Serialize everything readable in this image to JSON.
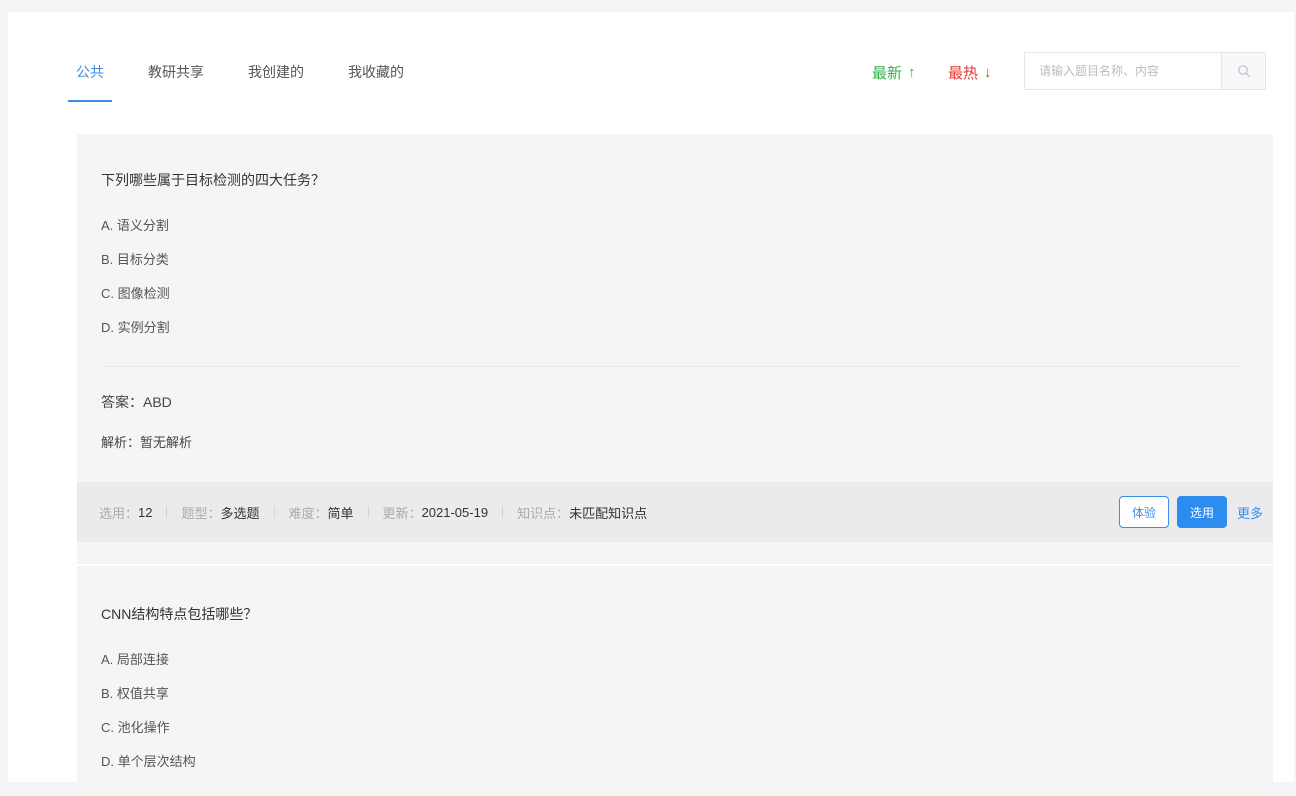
{
  "tabs": [
    {
      "label": "公共",
      "active": true
    },
    {
      "label": "教研共享",
      "active": false
    },
    {
      "label": "我创建的",
      "active": false
    },
    {
      "label": "我收藏的",
      "active": false
    }
  ],
  "sort": {
    "newest_label": "最新",
    "newest_arrow": "↑",
    "hottest_label": "最热",
    "hottest_arrow": "↓"
  },
  "search": {
    "placeholder": "请输入题目名称、内容",
    "icon": "search-icon"
  },
  "questions": [
    {
      "title": "下列哪些属于目标检测的四大任务？",
      "options": [
        "A. 语义分割",
        "B. 目标分类",
        "C. 图像检测",
        "D. 实例分割"
      ],
      "answer_label": "答案：",
      "answer": "ABD",
      "analysis_label": "解析：",
      "analysis": "暂无解析",
      "meta": {
        "used_label": "选用：",
        "used": "12",
        "type_label": "题型：",
        "type": "多选题",
        "difficulty_label": "难度：",
        "difficulty": "简单",
        "updated_label": "更新：",
        "updated": "2021-05-19",
        "knowledge_label": "知识点：",
        "knowledge": "未匹配知识点"
      },
      "actions": {
        "trial": "体验",
        "select": "选用",
        "more": "更多"
      }
    },
    {
      "title": "CNN结构特点包括哪些？",
      "options": [
        "A. 局部连接",
        "B. 权值共享",
        "C. 池化操作",
        "D. 单个层次结构"
      ]
    }
  ],
  "colors": {
    "primary": "#3a8ee6",
    "newest": "#2fb344",
    "hottest": "#e53935",
    "card_bg": "#f5f5f6",
    "meta_bg": "#ebebed"
  }
}
